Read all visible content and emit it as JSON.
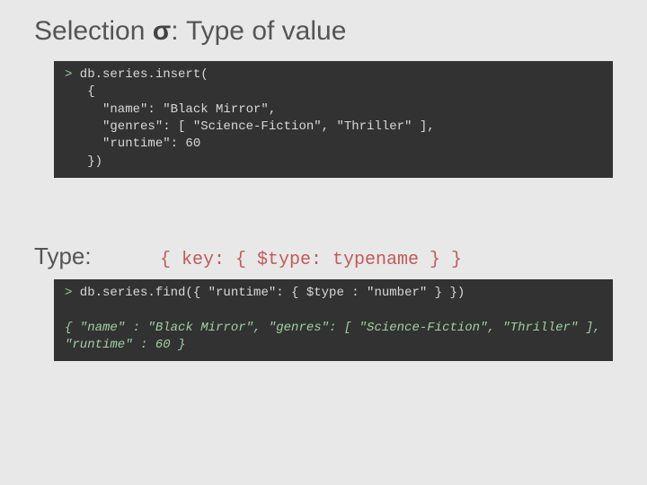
{
  "title_pre": "Selection ",
  "title_sigma": "σ",
  "title_post": ": Type of value",
  "code_insert": {
    "prompt": ">",
    "l1": " db.series.insert(",
    "l2": "   {",
    "l3": "     \"name\": \"Black Mirror\",",
    "l4": "     \"genres\": [ \"Science-Fiction\", \"Thriller\" ],",
    "l5": "     \"runtime\": 60",
    "l6": "   })"
  },
  "type_label": "Type:",
  "type_expr": "{ key: { $type: typename } }",
  "code_find": {
    "prompt": ">",
    "l1": " db.series.find({ \"runtime\": { $type : \"number\" } })",
    "result": "{ \"name\" : \"Black Mirror\", \"genres\": [ \"Science-Fiction\", \"Thriller\" ],\n\"runtime\" : 60 }"
  }
}
